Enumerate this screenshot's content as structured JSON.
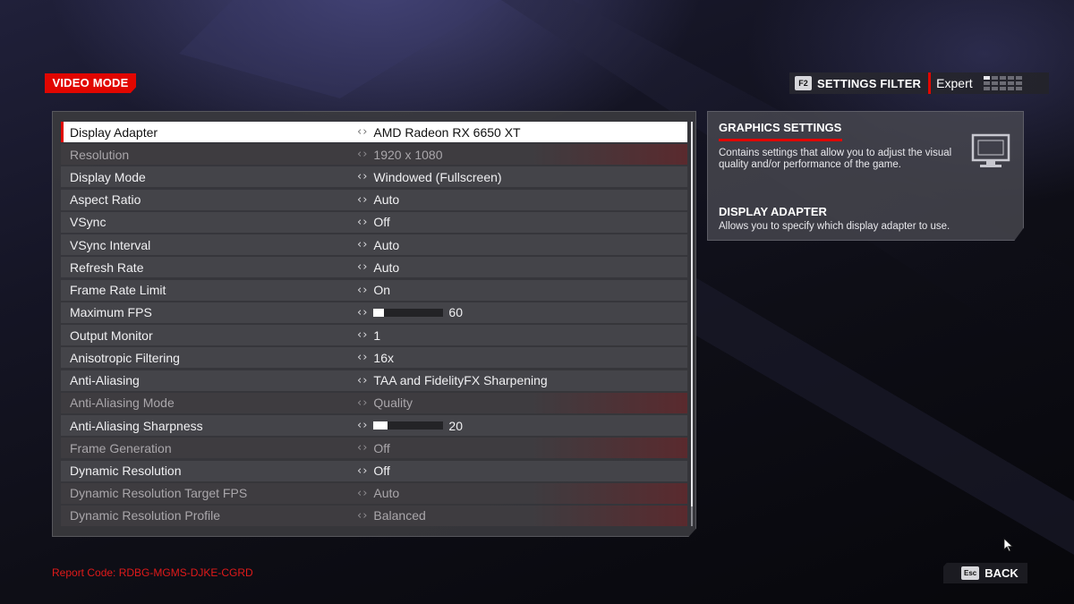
{
  "header": {
    "mode_tag": "VIDEO MODE",
    "settings_filter": {
      "key": "F2",
      "label": "SETTINGS FILTER",
      "value": "Expert",
      "level": "highest of grid"
    }
  },
  "settings": [
    {
      "label": "Display Adapter",
      "value": "AMD Radeon RX 6650 XT",
      "state": "selected"
    },
    {
      "label": "Resolution",
      "value": "1920 x 1080",
      "state": "disabled"
    },
    {
      "label": "Display Mode",
      "value": "Windowed (Fullscreen)",
      "state": "normal"
    },
    {
      "label": "Aspect Ratio",
      "value": "Auto",
      "state": "normal"
    },
    {
      "label": "VSync",
      "value": "Off",
      "state": "normal"
    },
    {
      "label": "VSync Interval",
      "value": "Auto",
      "state": "normal"
    },
    {
      "label": "Refresh Rate",
      "value": "Auto",
      "state": "normal"
    },
    {
      "label": "Frame Rate Limit",
      "value": "On",
      "state": "normal"
    },
    {
      "label": "Maximum FPS",
      "value": "60",
      "state": "normal",
      "slider_fraction": 0.15
    },
    {
      "label": "Output Monitor",
      "value": "1",
      "state": "normal"
    },
    {
      "label": "Anisotropic Filtering",
      "value": "16x",
      "state": "normal"
    },
    {
      "label": "Anti-Aliasing",
      "value": "TAA and FidelityFX Sharpening",
      "state": "normal"
    },
    {
      "label": "Anti-Aliasing Mode",
      "value": "Quality",
      "state": "disabled"
    },
    {
      "label": "Anti-Aliasing Sharpness",
      "value": "20",
      "state": "normal",
      "slider_fraction": 0.2
    },
    {
      "label": "Frame Generation",
      "value": "Off",
      "state": "disabled"
    },
    {
      "label": "Dynamic Resolution",
      "value": "Off",
      "state": "normal"
    },
    {
      "label": "Dynamic Resolution Target FPS",
      "value": "Auto",
      "state": "disabled"
    },
    {
      "label": "Dynamic Resolution Profile",
      "value": "Balanced",
      "state": "disabled"
    }
  ],
  "info": {
    "title": "GRAPHICS SETTINGS",
    "description": "Contains settings that allow you to adjust the visual quality and/or performance of the game.",
    "subtitle": "DISPLAY ADAPTER",
    "subdescription": "Allows you to specify which display adapter to use.",
    "icon": "monitor-icon"
  },
  "footer": {
    "report_code": "Report Code: RDBG-MGMS-DJKE-CGRD",
    "back_key": "Esc",
    "back_label": "BACK"
  },
  "colors": {
    "accent": "#e10600",
    "panel": "#3a3a3e",
    "row": "#444449",
    "selected_row": "#ffffff"
  }
}
